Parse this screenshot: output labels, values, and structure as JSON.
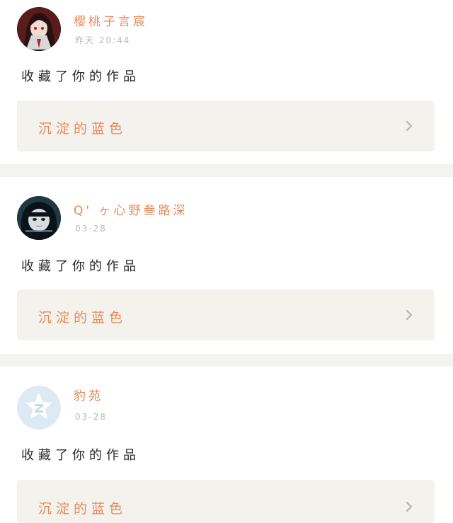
{
  "feed": {
    "items": [
      {
        "user": {
          "name": "樱桃子言宸",
          "avatar_icon": "anime-girl-avatar-icon"
        },
        "time": "昨天 20:44",
        "action": "收藏了你的作品",
        "work": {
          "title": "沉淀的蓝色",
          "chevron_icon": "chevron-right-icon"
        }
      },
      {
        "user": {
          "name": "Q' ヶ心野叁路深",
          "avatar_icon": "girl-photo-avatar-icon"
        },
        "time": "03-28",
        "action": "收藏了你的作品",
        "work": {
          "title": "沉淀的蓝色",
          "chevron_icon": "chevron-right-icon"
        }
      },
      {
        "user": {
          "name": "豹苑",
          "avatar_icon": "qq-default-avatar-icon"
        },
        "time": "03-28",
        "action": "收藏了你的作品",
        "work": {
          "title": "沉淀的蓝色",
          "chevron_icon": "chevron-right-icon"
        }
      }
    ]
  },
  "colors": {
    "accent": "#e8895a",
    "muted_text": "#b9b9b9",
    "body_text": "#2a2a2a",
    "card_bg": "#f3f2ec",
    "separator": "#f3f3f1"
  }
}
